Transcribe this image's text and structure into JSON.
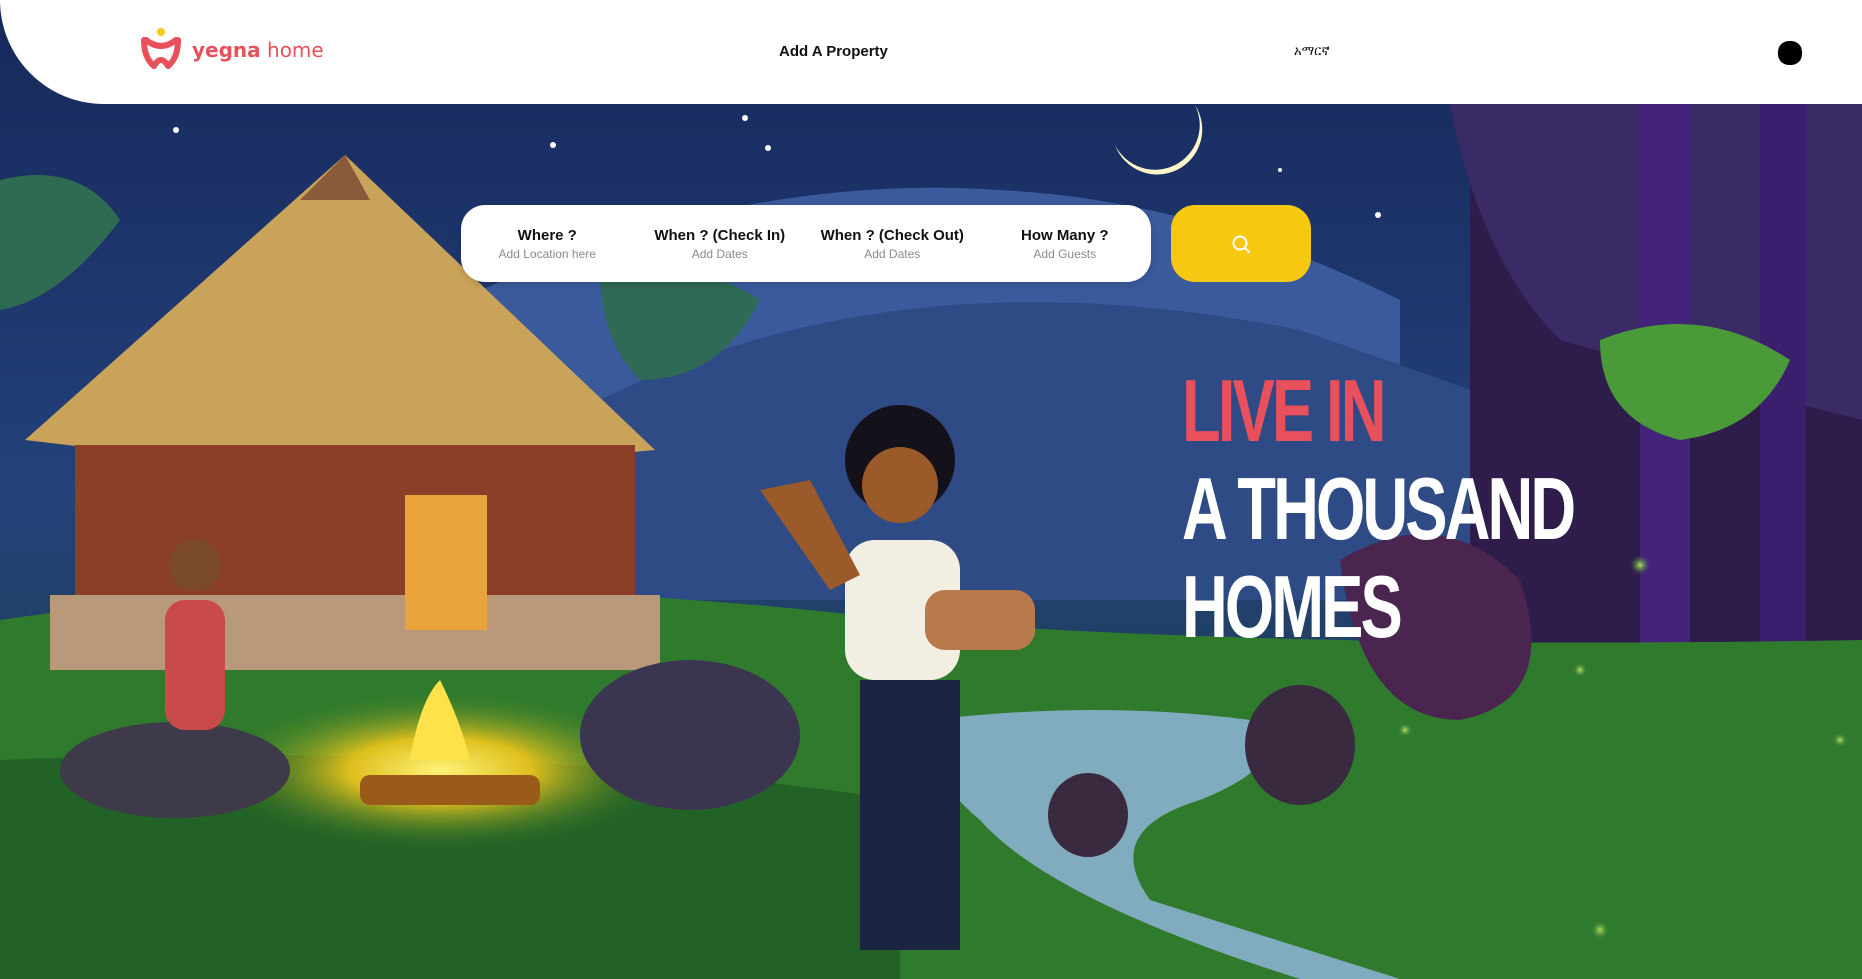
{
  "brand": {
    "name_bold": "yegna",
    "name_light": " home",
    "accent": "#e8505b"
  },
  "nav": {
    "add_property": "Add A Property",
    "language": "አማርኛ",
    "avatar_icon": "user-avatar-icon"
  },
  "search": {
    "fields": [
      {
        "title": "Where ?",
        "placeholder": "Add Location here"
      },
      {
        "title": "When ? (Check In)",
        "placeholder": "Add Dates"
      },
      {
        "title": "When ? (Check Out)",
        "placeholder": "Add Dates"
      },
      {
        "title": "How Many ?",
        "placeholder": "Add Guests"
      }
    ],
    "button_icon": "search-icon",
    "button_color": "#f7c811"
  },
  "hero": {
    "line1": "LIVE IN",
    "line2": "A THOUSAND",
    "line3": "HOMES"
  }
}
